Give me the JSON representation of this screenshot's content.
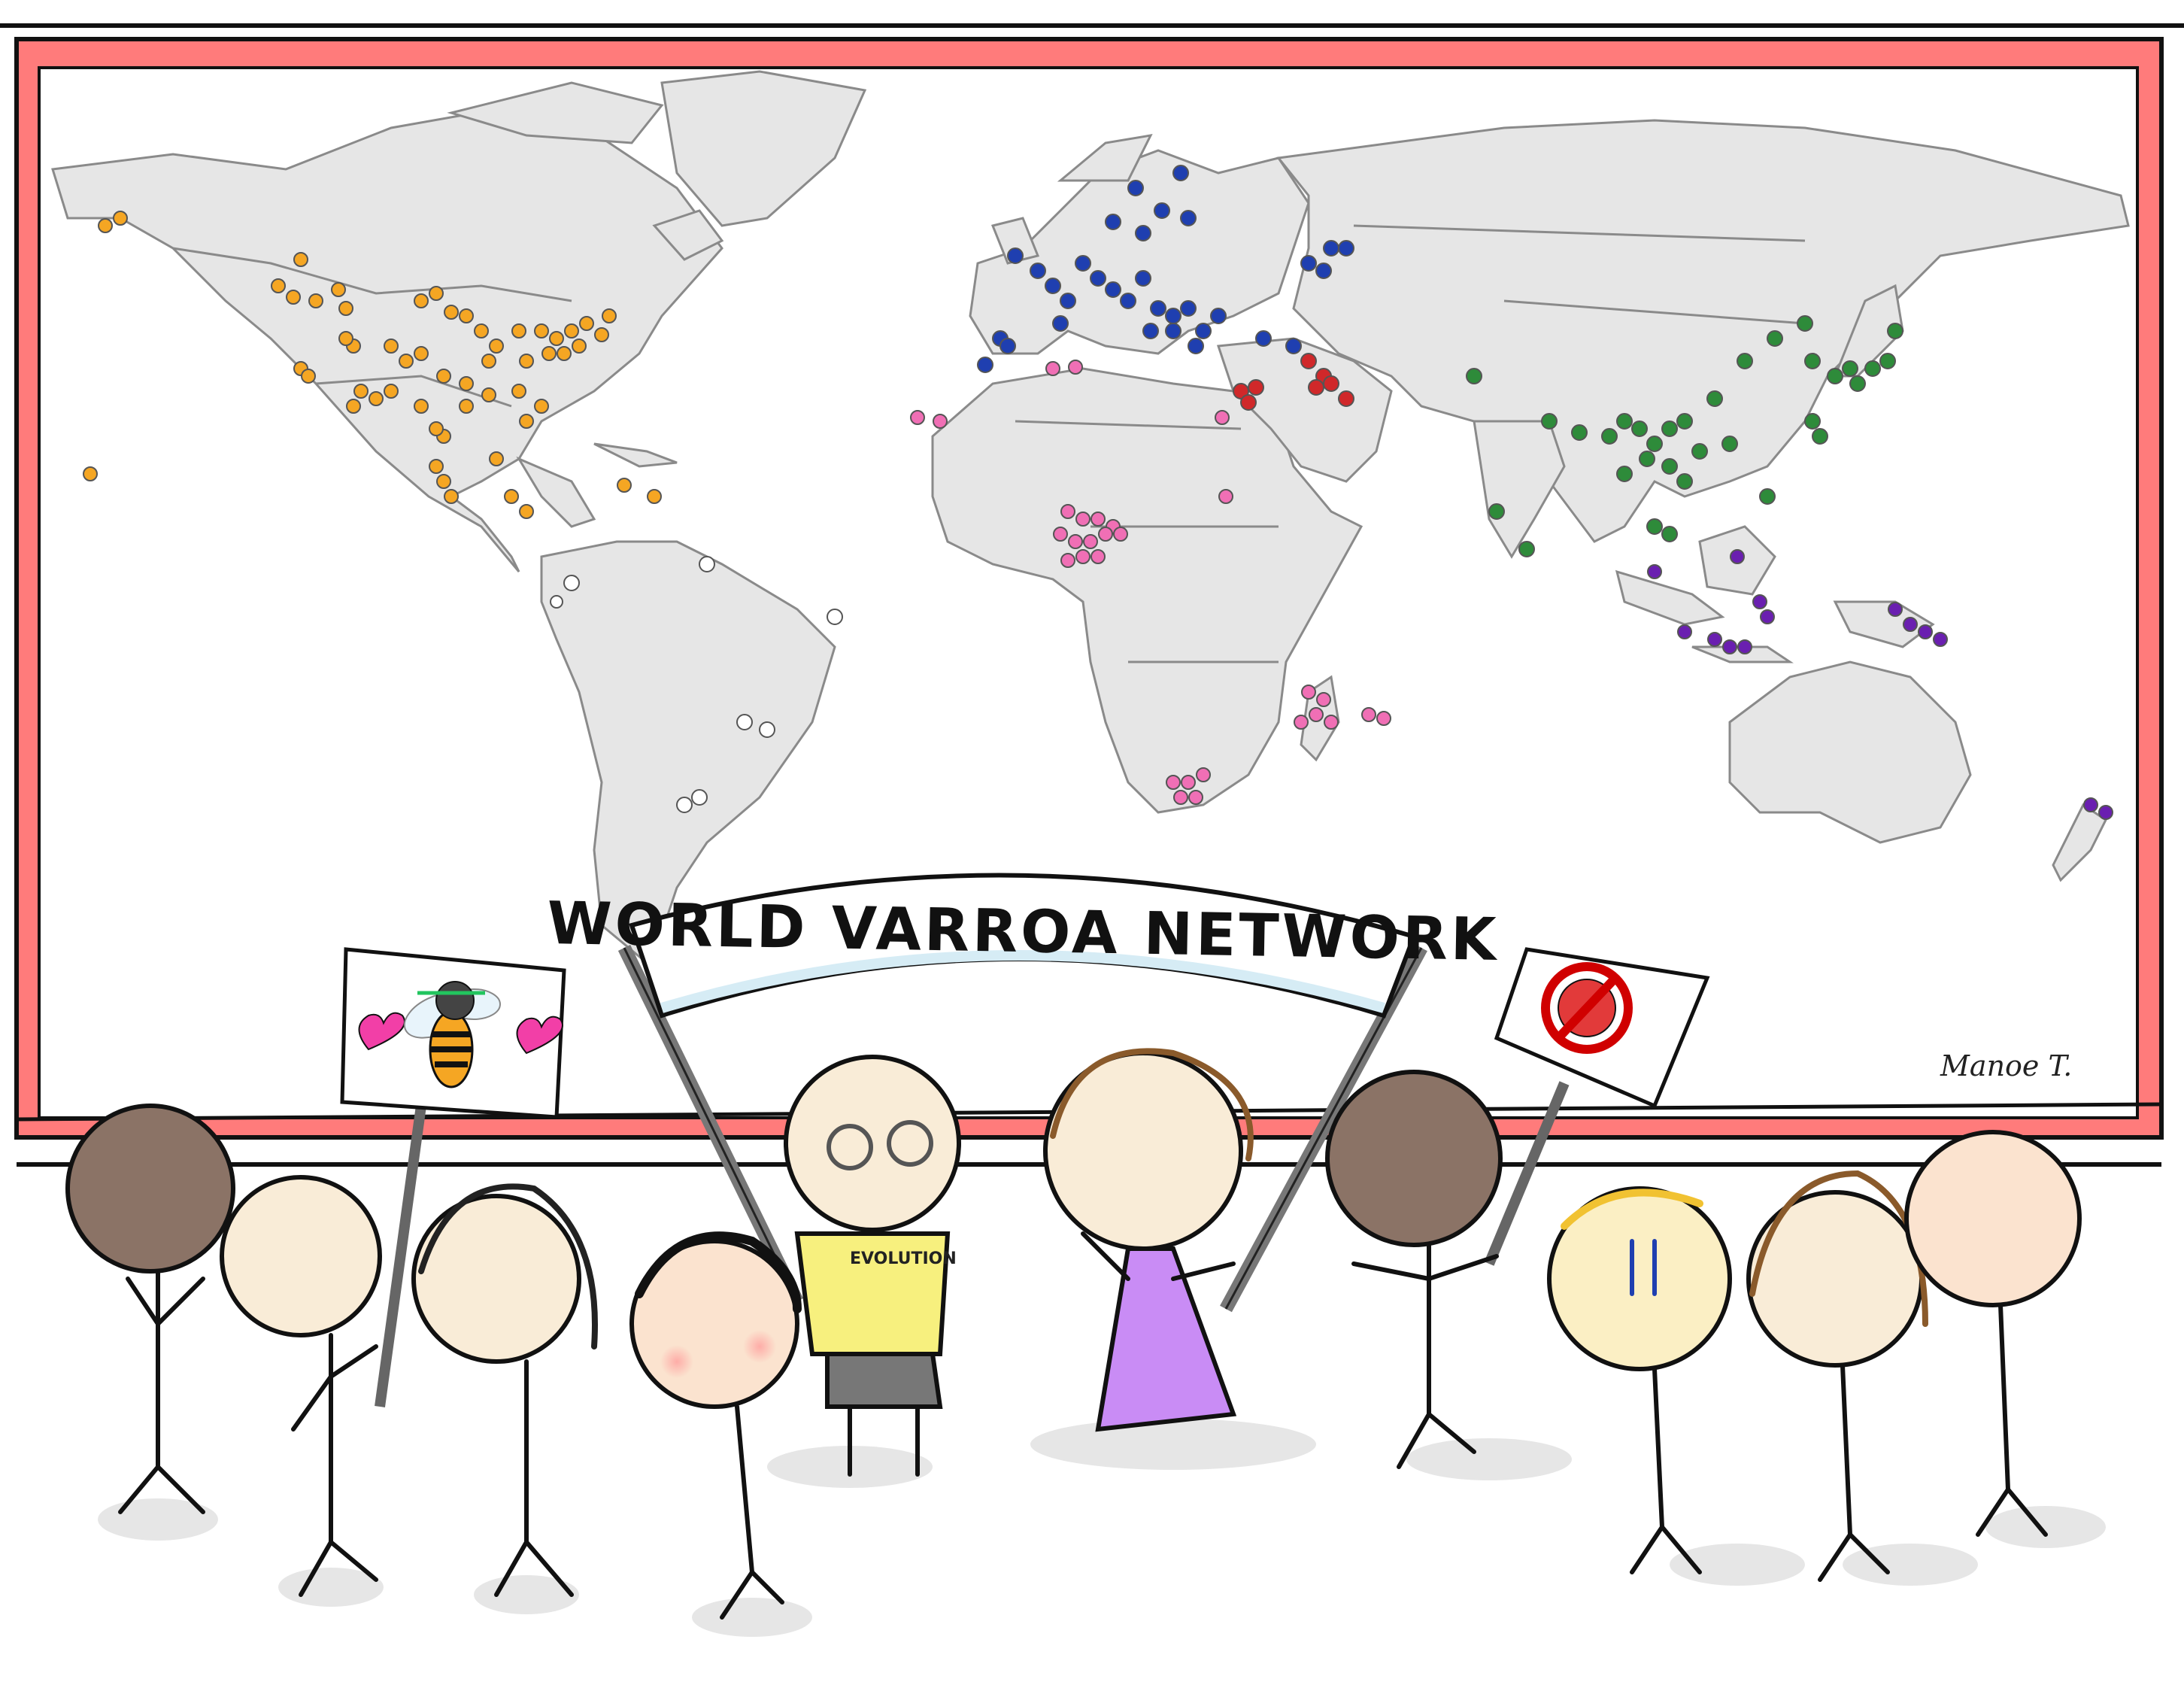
{
  "banner": {
    "text": "WORLD VARROA NETWORK"
  },
  "signature": "Manoe T.",
  "shirt_text": "EVOLUTION",
  "colors": {
    "frame": "#ff7b7b",
    "land": "#e6e6e6",
    "border": "#8a8a8a",
    "americas": "#f5a623",
    "europe": "#1f3fb0",
    "middle_east": "#d0282a",
    "africa": "#f06fb5",
    "east_asia": "#2e8b3a",
    "oceania": "#6a1fb0",
    "south_america": "#ffffff",
    "dress": "#c98cf5"
  },
  "icons": [
    "world-map",
    "honeybee-with-hearts-sign",
    "no-mite-sign",
    "banner-poles"
  ]
}
